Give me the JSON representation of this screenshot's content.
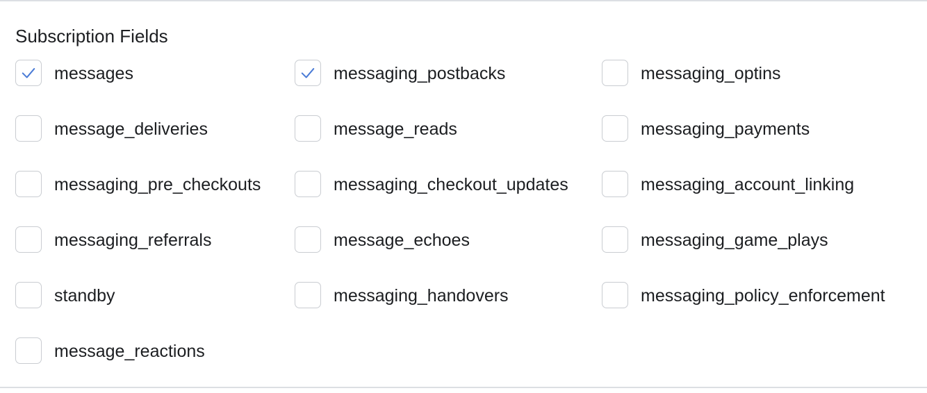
{
  "section": {
    "title": "Subscription Fields"
  },
  "colors": {
    "checkmark": "#4a7bd6",
    "checkbox_border": "#c9ccd1",
    "divider": "#dcdfe3",
    "text": "#1c1e21"
  },
  "fields": [
    {
      "label": "messages",
      "checked": true
    },
    {
      "label": "messaging_postbacks",
      "checked": true
    },
    {
      "label": "messaging_optins",
      "checked": false
    },
    {
      "label": "message_deliveries",
      "checked": false
    },
    {
      "label": "message_reads",
      "checked": false
    },
    {
      "label": "messaging_payments",
      "checked": false
    },
    {
      "label": "messaging_pre_checkouts",
      "checked": false
    },
    {
      "label": "messaging_checkout_updates",
      "checked": false
    },
    {
      "label": "messaging_account_linking",
      "checked": false
    },
    {
      "label": "messaging_referrals",
      "checked": false
    },
    {
      "label": "message_echoes",
      "checked": false
    },
    {
      "label": "messaging_game_plays",
      "checked": false
    },
    {
      "label": "standby",
      "checked": false
    },
    {
      "label": "messaging_handovers",
      "checked": false
    },
    {
      "label": "messaging_policy_enforcement",
      "checked": false
    },
    {
      "label": "message_reactions",
      "checked": false
    }
  ]
}
